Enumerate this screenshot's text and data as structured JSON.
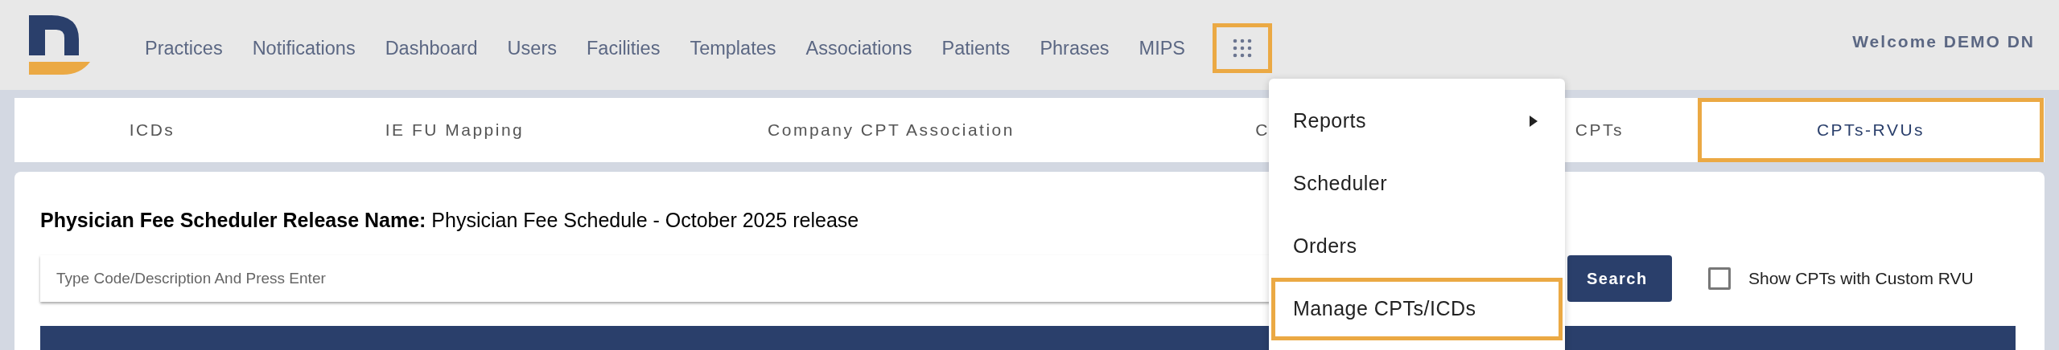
{
  "nav": {
    "items": [
      {
        "label": "Practices"
      },
      {
        "label": "Notifications"
      },
      {
        "label": "Dashboard"
      },
      {
        "label": "Users"
      },
      {
        "label": "Facilities"
      },
      {
        "label": "Templates"
      },
      {
        "label": "Associations"
      },
      {
        "label": "Patients"
      },
      {
        "label": "Phrases"
      },
      {
        "label": "MIPS"
      }
    ],
    "apps_button": {
      "highlighted": true
    },
    "welcome": "Welcome DEMO DN"
  },
  "tabs": [
    {
      "label": "ICDs",
      "selected": false
    },
    {
      "label": "IE FU Mapping",
      "selected": false
    },
    {
      "label": "Company CPT Association",
      "selected": false
    },
    {
      "label": "C",
      "selected": false
    },
    {
      "label": "CPTs",
      "selected": false
    },
    {
      "label": "CPTs-RVUs",
      "selected": true
    }
  ],
  "menu": {
    "items": [
      {
        "label": "Reports",
        "has_submenu": true,
        "highlighted": false
      },
      {
        "label": "Scheduler",
        "has_submenu": false,
        "highlighted": false
      },
      {
        "label": "Orders",
        "has_submenu": false,
        "highlighted": false
      },
      {
        "label": "Manage CPTs/ICDs",
        "has_submenu": false,
        "highlighted": true
      }
    ]
  },
  "release": {
    "label": "Physician Fee Scheduler Release Name:",
    "value": "Physician Fee Schedule - October 2025 release"
  },
  "search": {
    "placeholder": "Type Code/Description And Press Enter",
    "button": "Search"
  },
  "filter": {
    "label": "Show CPTs with Custom RVU",
    "checked": false
  }
}
